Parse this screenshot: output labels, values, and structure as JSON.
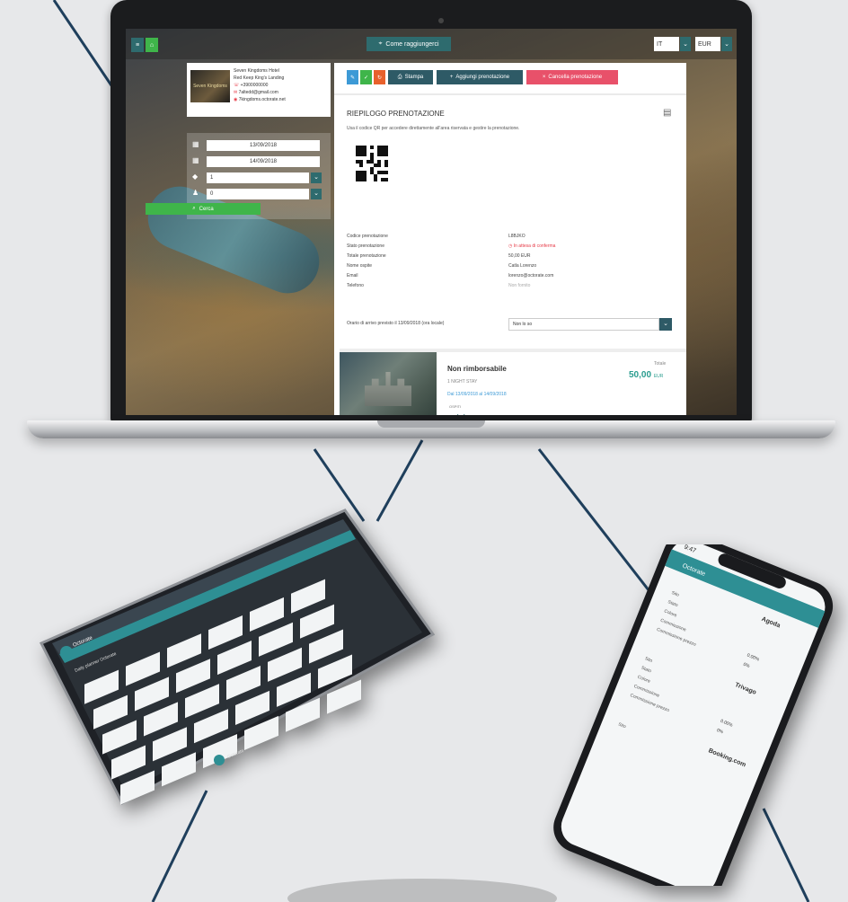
{
  "laptop": {
    "topbar": {
      "how_to_reach": "Come raggiungerci",
      "language": "IT",
      "currency": "EUR"
    },
    "hotel": {
      "name": "Seven Kingdoms Hotel",
      "address": "Red Keep King's Landing",
      "phone": "+3900000000",
      "email": "7altedd@gmail.com",
      "website": "7kingdoms.octorate.net",
      "logo_text": "Seven Kingdoms"
    },
    "search": {
      "checkin": "13/09/2018",
      "checkout": "14/09/2018",
      "rooms": "1",
      "guests": "0",
      "search_button": "Cerca"
    },
    "actions": {
      "print": "Stampa",
      "add_booking": "Aggiungi prenotazione",
      "cancel_booking": "Cancella prenotazione"
    },
    "summary": {
      "title": "RIEPILOGO PRENOTAZIONE",
      "description": "Usa il codice QR per accedere direttamente all'area riservata e gestire la prenotazione.",
      "fields": [
        {
          "label": "Codice prenotazione",
          "value": "L8BJKO"
        },
        {
          "label": "Stato prenotazione",
          "value": "In attesa di conferma",
          "status": true
        },
        {
          "label": "Totale prenotazione",
          "value": "50,00 EUR"
        },
        {
          "label": "Nome ospite",
          "value": "Catla Lorenzo"
        },
        {
          "label": "Email",
          "value": "lorenzo@octorate.com"
        },
        {
          "label": "Telefono",
          "value": "Non fornito"
        }
      ],
      "arrival_label": "Orario di arrivo previsto il 13/09/2018 (ora locale)",
      "arrival_value": "Non lo so"
    },
    "room": {
      "name": "Non rimborsabile",
      "nights": "1 NIGHT STAY",
      "dates": "Dal 13/09/2018 al 14/09/2018",
      "ospiti_label": "OSPITI",
      "total_label": "Totale",
      "total_value": "50,00",
      "total_currency": "EUR"
    }
  },
  "tablet": {
    "app_name": "Octorate",
    "calendar_title": "Daily planner Octorate",
    "footer_brand": "Octorate"
  },
  "phone": {
    "time": "9:47",
    "app_name": "Octorate",
    "channels": [
      {
        "name": "Agoda",
        "rows": [
          "Sito",
          "Stato",
          "Colore",
          "Commissione",
          "Commissione prezzo"
        ],
        "values": [
          "",
          "",
          "",
          "0.00%",
          "0%"
        ]
      },
      {
        "name": "Trivago",
        "rows": [
          "Sito",
          "Stato",
          "Colore",
          "Commissione",
          "Commissione prezzo"
        ],
        "values": [
          "",
          "",
          "",
          "0.00%",
          "0%"
        ]
      },
      {
        "name": "Booking.com",
        "rows": [
          "Sito"
        ],
        "values": [
          ""
        ]
      }
    ]
  },
  "colors": {
    "teal": "#2e6b6e",
    "green": "#3fb54a",
    "blue": "#3d9ad6",
    "red": "#e63946",
    "pink": "#e8516a",
    "dark": "#26303a",
    "line": "#1f3f5c"
  }
}
